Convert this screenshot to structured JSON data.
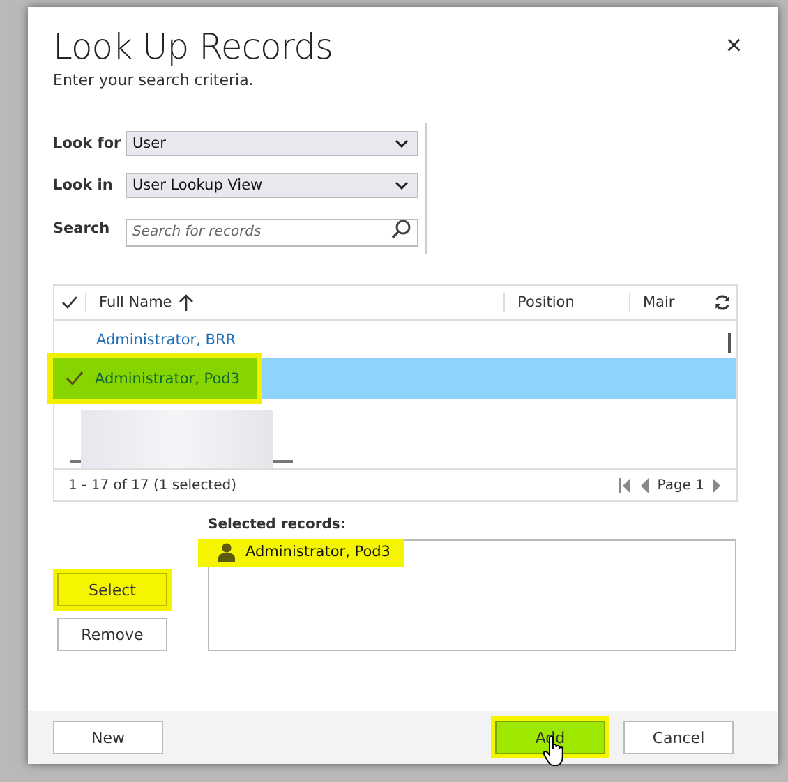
{
  "dialog": {
    "title": "Look Up Records",
    "subtitle": "Enter your search criteria.",
    "close": "×"
  },
  "criteria": [
    {
      "kind": "select",
      "label": "Look for",
      "value": "User"
    },
    {
      "kind": "select",
      "label": "Look in",
      "value": "User Lookup View"
    },
    {
      "kind": "search",
      "label": "Search",
      "placeholder": "Search for records"
    }
  ],
  "grid": {
    "columns": [
      {
        "label": "Full Name",
        "sorted": true
      },
      {
        "label": "Position",
        "sorted": false
      },
      {
        "label": "Mair",
        "sorted": false
      }
    ],
    "rows": [
      {
        "kind": "record",
        "name": "Administrator, BRR",
        "selected": false,
        "highlighted": false
      },
      {
        "kind": "record",
        "name": "Administrator, Pod3",
        "selected": true,
        "highlighted": true
      },
      {
        "kind": "redacted"
      }
    ],
    "status": "1 - 17 of 17 (1 selected)",
    "page": "Page 1"
  },
  "selected_records": {
    "label": "Selected records:",
    "items": [
      {
        "name": "Administrator, Pod3",
        "highlighted": true
      }
    ]
  },
  "side_buttons": [
    {
      "label": "Select",
      "highlighted": true
    },
    {
      "label": "Remove",
      "highlighted": false
    }
  ],
  "footer_buttons": [
    {
      "label": "New",
      "primary": false,
      "highlighted": false
    },
    {
      "label": "Add",
      "primary": true,
      "highlighted": true
    },
    {
      "label": "Cancel",
      "primary": false,
      "highlighted": false
    }
  ]
}
